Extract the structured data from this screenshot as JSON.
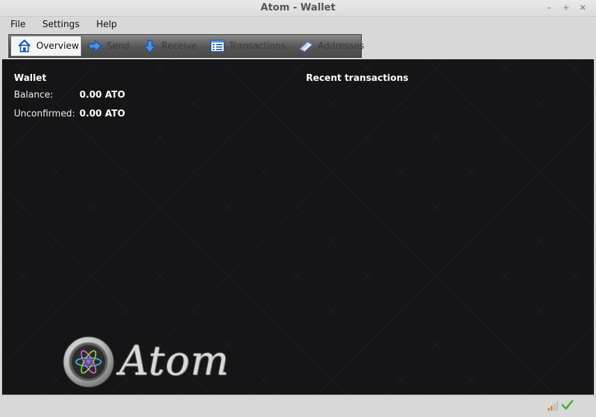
{
  "window": {
    "title": "Atom - Wallet"
  },
  "menu": {
    "file": "File",
    "settings": "Settings",
    "help": "Help"
  },
  "toolbar": {
    "tabs": [
      {
        "label": "Overview",
        "icon": "home-icon",
        "active": true
      },
      {
        "label": "Send",
        "icon": "arrow-right-icon",
        "active": false
      },
      {
        "label": "Receive",
        "icon": "arrow-down-icon",
        "active": false
      },
      {
        "label": "Transactions",
        "icon": "list-icon",
        "active": false
      },
      {
        "label": "Addresses",
        "icon": "address-book-icon",
        "active": false
      }
    ]
  },
  "wallet": {
    "title": "Wallet",
    "balance_label": "Balance:",
    "balance_value": "0.00 ATO",
    "unconfirmed_label": "Unconfirmed:",
    "unconfirmed_value": "0.00 ATO"
  },
  "recent": {
    "title": "Recent transactions"
  },
  "brand": {
    "name": "Atom"
  },
  "status": {
    "connections_icon": "signal-bars-icon",
    "sync_icon": "checkmark-icon",
    "accent_green": "#3fae2a"
  }
}
